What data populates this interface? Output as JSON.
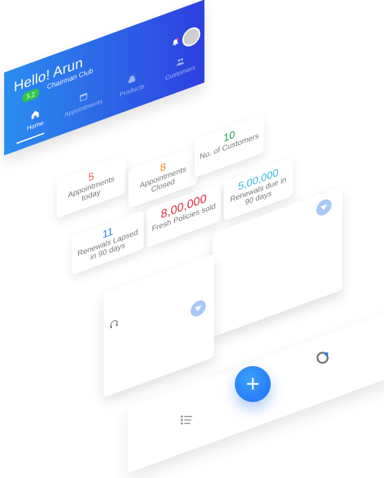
{
  "header": {
    "greeting": "Hello! Arun",
    "badge": "3.2",
    "club": "Chairman Club",
    "bell_icon": "bell-icon",
    "avatar_icon": "avatar"
  },
  "nav": {
    "items": [
      {
        "label": "Home",
        "icon": "home-icon",
        "active": true
      },
      {
        "label": "Appointments",
        "icon": "calendar-icon",
        "active": false
      },
      {
        "label": "Products",
        "icon": "products-icon",
        "active": false
      },
      {
        "label": "Customers",
        "icon": "users-icon",
        "active": false
      }
    ]
  },
  "stats": [
    {
      "value": "5",
      "label": "Appointments today",
      "color": "#f05a57"
    },
    {
      "value": "8",
      "label": "Appointments Closed",
      "color": "#f08a2a"
    },
    {
      "value": "10",
      "label": "No. of Customers",
      "color": "#2f9a5a"
    },
    {
      "value": "8,00,000",
      "label": "Fresh Policies sold",
      "color": "#e02f3f"
    },
    {
      "value": "5,00,000",
      "label": "Renewals due in 90 days",
      "color": "#39b8e0"
    },
    {
      "value": "11",
      "label": "Renewals Lapsed in 90 days",
      "color": "#2f7fe6"
    }
  ],
  "colors": {
    "header_start": "#2b8df0",
    "header_end": "#2f3fe0",
    "fab": "#1f6ff0",
    "badge": "#32c64a"
  },
  "bottom": {
    "fab_label": "+",
    "list_icon": "list-icon",
    "refresh_icon": "refresh-icon"
  }
}
